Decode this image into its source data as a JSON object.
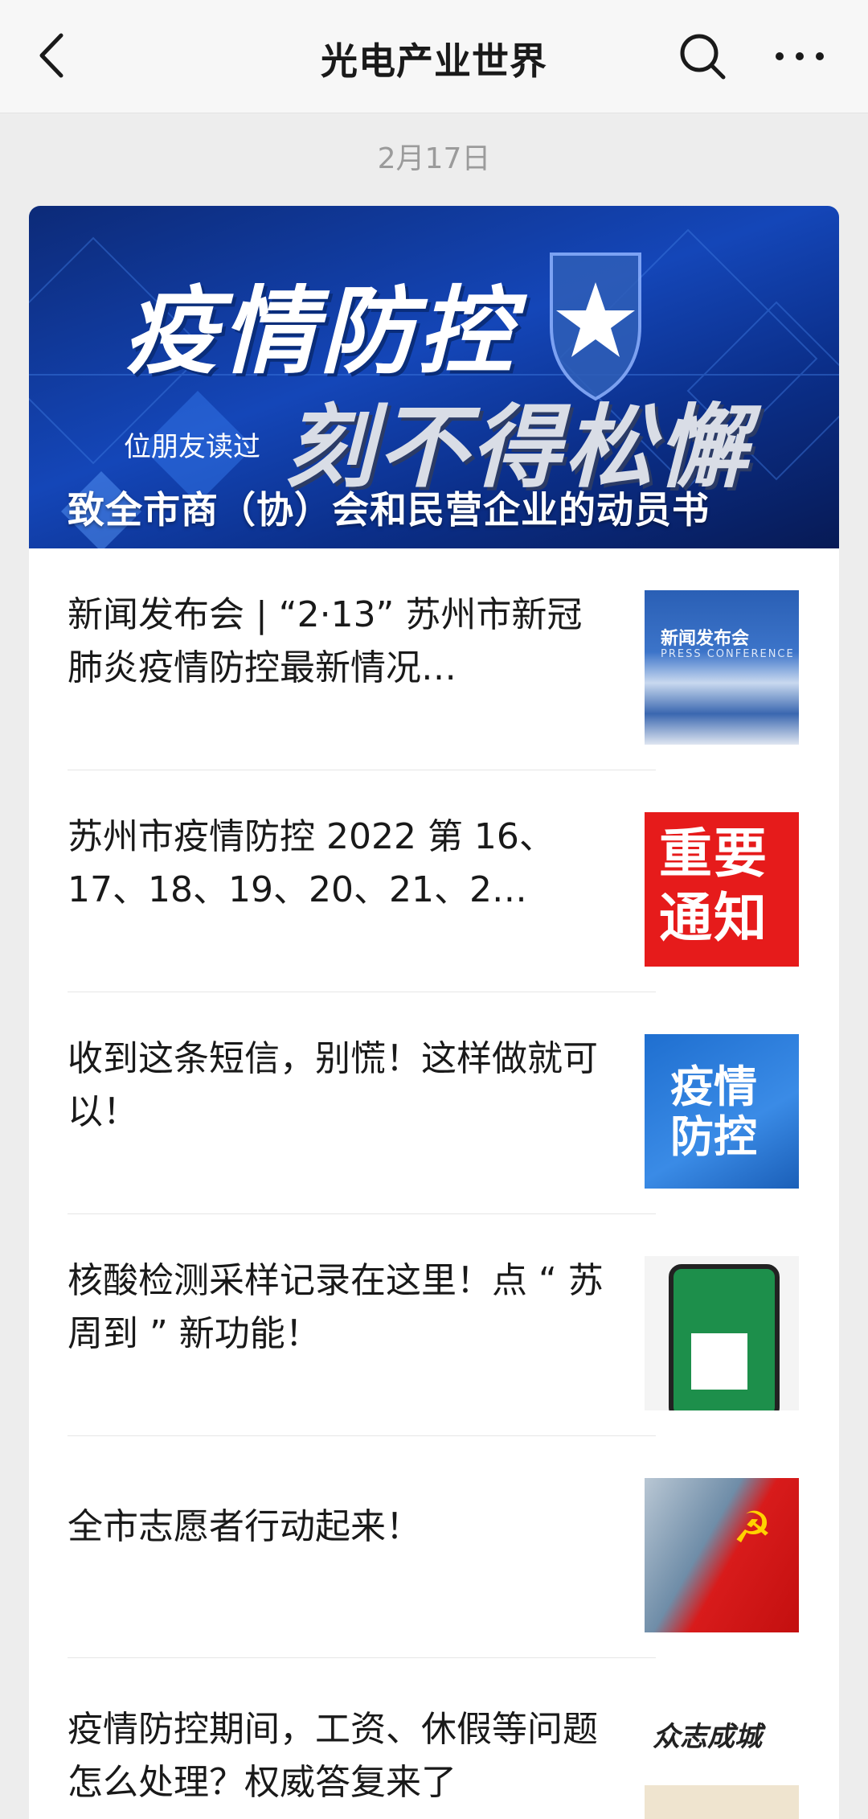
{
  "header": {
    "title": "光电产业世界",
    "back_icon": "chevron-left-icon",
    "search_icon": "search-icon",
    "more_icon": "more-icon"
  },
  "date": "2月17日",
  "hero": {
    "image_text_line1": "疫情防控",
    "image_text_line2": "刻不得松懈",
    "friends_read": "位朋友读过",
    "caption": "致全市商（协）会和民营企业的动员书"
  },
  "articles": [
    {
      "title": "新闻发布会 | “2·13” 苏州市新冠肺炎疫情防控最新情况…",
      "thumb_label": "新闻发布会",
      "thumb_label_en": "PRESS CONFERENCE"
    },
    {
      "title": "苏州市疫情防控 2022 第 16、17、18、19、20、21、2…",
      "thumb_line1": "重要",
      "thumb_line2": "通知"
    },
    {
      "title": "收到这条短信，别慌！这样做就可以！",
      "thumb_line1": "疫情",
      "thumb_line2": "防控"
    },
    {
      "title": "核酸检测采样记录在这里！点 “ 苏周到 ” 新功能！"
    },
    {
      "title": "全市志愿者行动起来！",
      "thumb_symbol": "☭"
    },
    {
      "title": "疫情防控期间，工资、休假等问题怎么处理？权威答复来了",
      "thumb_heading": "众志成城"
    }
  ],
  "colors": {
    "background": "#ededed",
    "card": "#ffffff",
    "red_notice": "#e61b1b"
  }
}
